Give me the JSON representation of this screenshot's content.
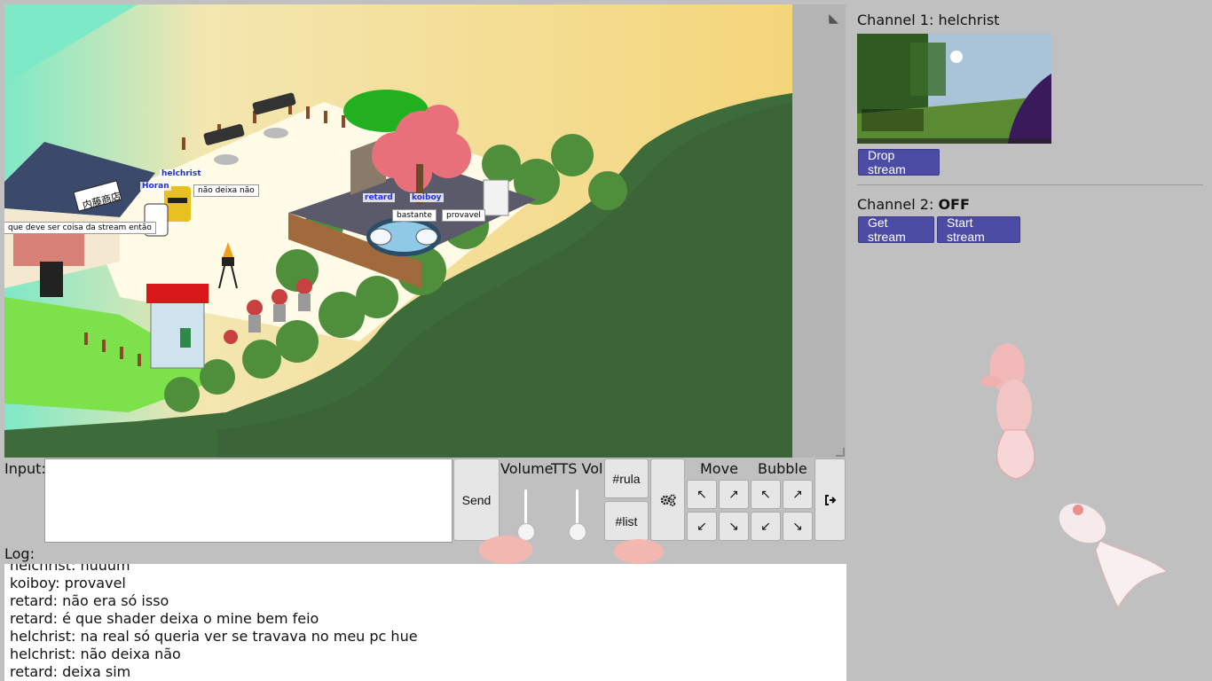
{
  "game": {
    "characters": [
      {
        "name": "helchrist",
        "bubble": "não deixa não"
      },
      {
        "name": "Horan",
        "bubble": "que deve ser coisa da stream então"
      },
      {
        "name": "retard",
        "bubble": "bastante"
      },
      {
        "name": "koiboy",
        "bubble": "provavel"
      }
    ],
    "shop_sign": "内藤商店"
  },
  "controls": {
    "input_label": "Input:",
    "input_value": "",
    "send_label": "Send",
    "volume_label": "Volume",
    "tts_label": "TTS Vol.",
    "rula_label": "#rula",
    "list_label": "#list",
    "move_label": "Move",
    "bubble_label": "Bubble",
    "arrows": {
      "up_left": "↖",
      "up_right": "↗",
      "down_left": "↙",
      "down_right": "↘"
    },
    "settings_icon": "gears-icon",
    "logout_icon": "logout-icon"
  },
  "log": {
    "label": "Log:",
    "lines": [
      "helchrist: huuum",
      "koiboy: provavel",
      "retard: não era só isso",
      "retard: é que shader deixa o mine bem feio",
      "helchrist: na real só queria ver se travava no meu pc hue",
      "helchrist: não deixa não",
      "retard: deixa sim"
    ]
  },
  "streams": {
    "channel1": {
      "label": "Channel 1: ",
      "user": "helchrist",
      "button": "Drop stream"
    },
    "channel2": {
      "label": "Channel 2: ",
      "status": "OFF",
      "get_button": "Get stream",
      "start_button": "Start stream"
    }
  },
  "colors": {
    "button_accent": "#4c4ca4",
    "name_tag": "#2030e0"
  }
}
